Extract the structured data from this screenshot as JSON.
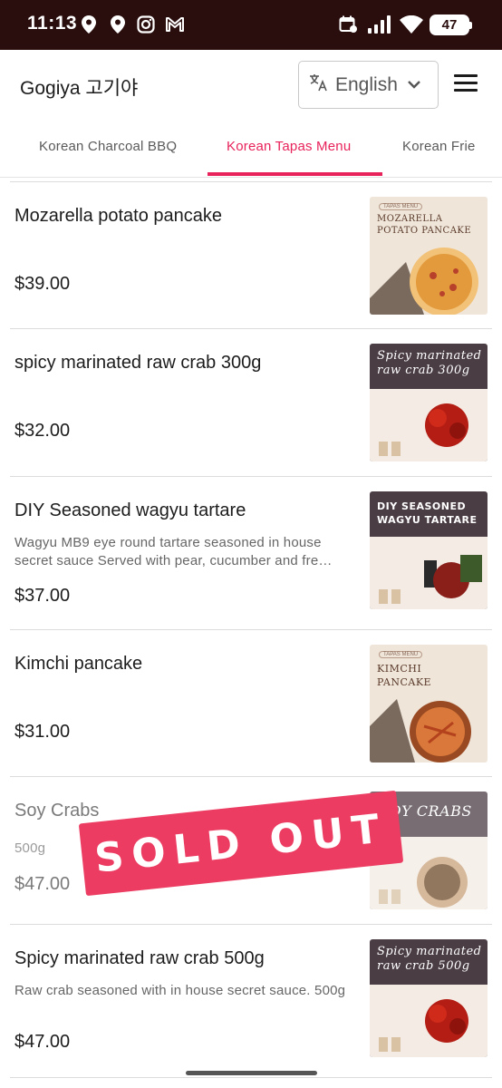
{
  "status_bar": {
    "time": "11:13",
    "battery": "47",
    "icons": [
      "location-pin-icon",
      "location-pin-icon",
      "instagram-icon",
      "gmail-icon",
      "calendar-icon",
      "signal-icon",
      "wifi-icon",
      "battery-icon"
    ]
  },
  "header": {
    "title": "Gogiya 고기야",
    "language": "English",
    "language_icon": "translate-icon",
    "menu_icon": "hamburger-icon"
  },
  "tabs": [
    {
      "label": "Korean Charcoal BBQ",
      "active": false
    },
    {
      "label": "Korean Tapas Menu",
      "active": true
    },
    {
      "label": "Korean Frie",
      "active": false
    }
  ],
  "items": [
    {
      "name": "Mozarella potato pancake",
      "description": "",
      "price": "$39.00",
      "sold_out": false,
      "image": {
        "badge": "TAPAS MENU",
        "title_line1": "MOZARELLA",
        "title_line2": "POTATO PANCAKE"
      }
    },
    {
      "name": "spicy marinated raw crab 300g",
      "description": "",
      "price": "$32.00",
      "sold_out": false,
      "image": {
        "title_line1": "Spicy marinated",
        "title_line2": "raw crab 300g"
      }
    },
    {
      "name": "DIY Seasoned wagyu tartare",
      "description": "Wagyu MB9 eye round tartare seasoned in house secret sauce Served with pear, cucumber and fre…",
      "price": "$37.00",
      "sold_out": false,
      "image": {
        "title_line1": "DIY SEASONED",
        "title_line2": "WAGYU TARTARE"
      }
    },
    {
      "name": "Kimchi pancake",
      "description": "",
      "price": "$31.00",
      "sold_out": false,
      "image": {
        "badge": "TAPAS MENU",
        "title_line1": "KIMCHI",
        "title_line2": "PANCAKE"
      }
    },
    {
      "name": "Soy Crabs",
      "description": "500g",
      "price": "$47.00",
      "sold_out": true,
      "image": {
        "title_line1": "SOY CRABS",
        "title_line2": ""
      }
    },
    {
      "name": "Spicy marinated raw crab 500g",
      "description": "Raw crab seasoned with in house secret sauce. 500g",
      "price": "$47.00",
      "sold_out": false,
      "image": {
        "title_line1": "Spicy marinated",
        "title_line2": "raw crab 500g"
      }
    }
  ],
  "sold_out_label": "SOLD OUT",
  "colors": {
    "accent": "#e8235b",
    "status_bar": "#2a0d0d",
    "sold_out": "#ec3c62"
  }
}
